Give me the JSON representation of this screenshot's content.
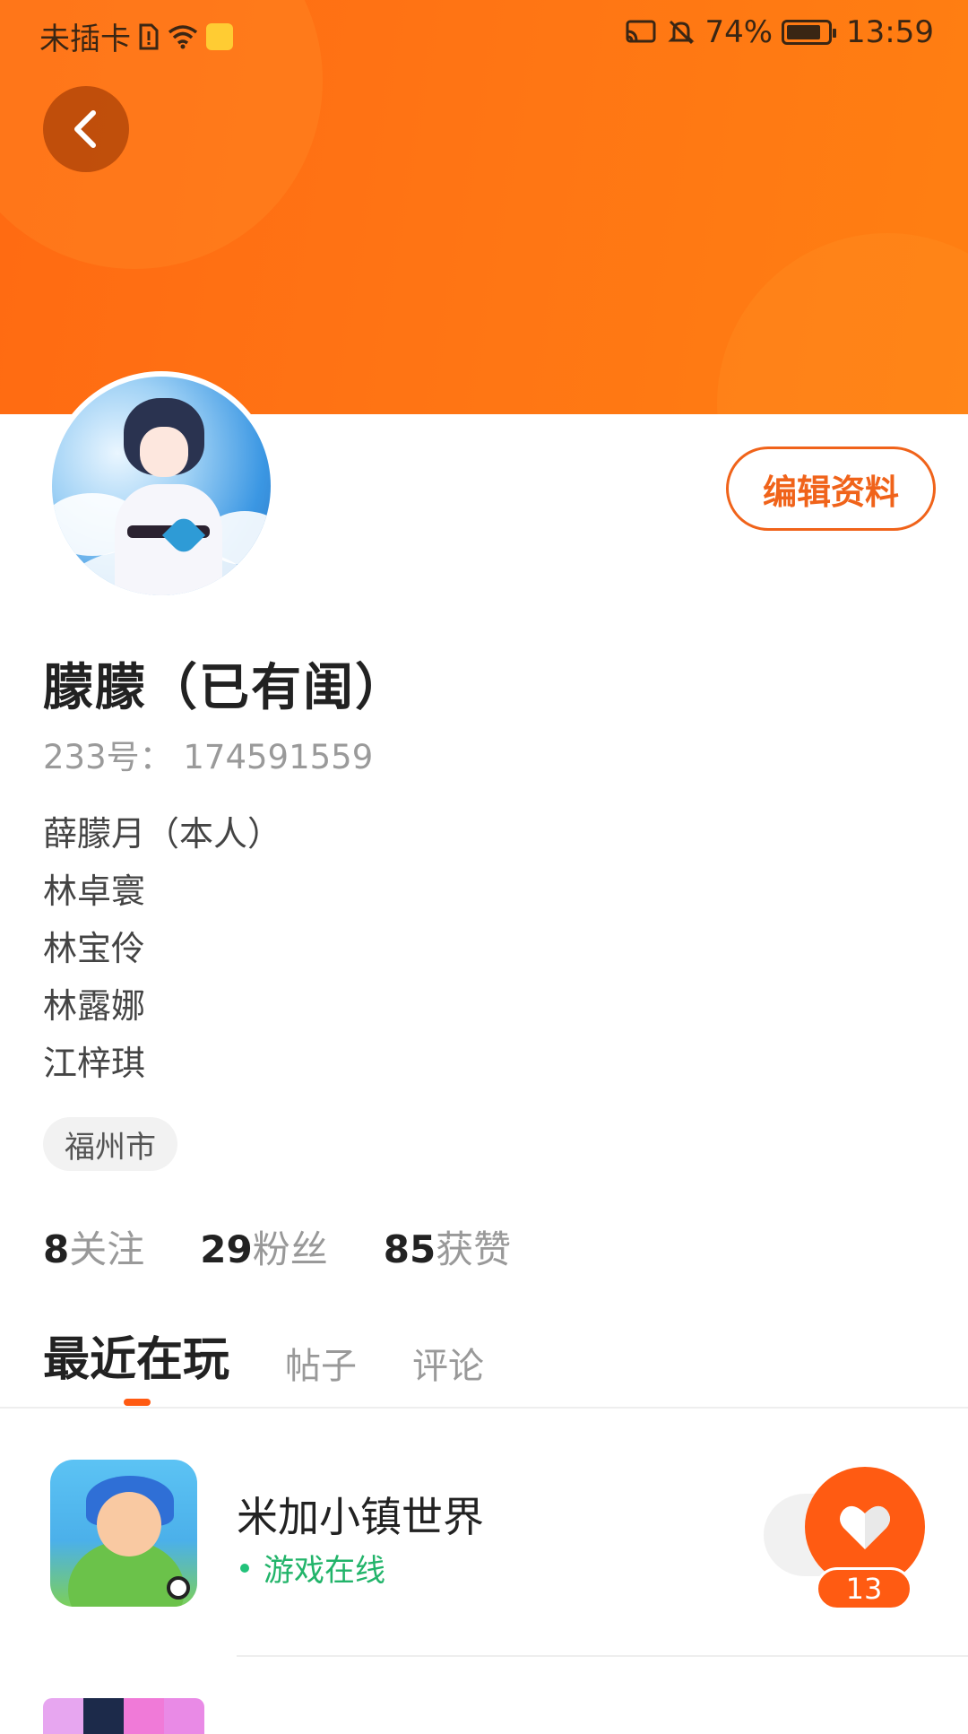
{
  "status_bar": {
    "carrier": "未插卡",
    "battery_percent": "74%",
    "battery_level": 0.74,
    "time": "13:59"
  },
  "header": {
    "back_icon": "chevron-left-icon",
    "banner_color": "#ff7414"
  },
  "profile": {
    "avatar_icon": "avatar-anime-girl",
    "edit_label": "编辑资料",
    "nickname": "朦朦（已有闺）",
    "uid": "233号：  174591559",
    "bio_lines": [
      "薛朦月（本人）",
      "林卓寰",
      "林宝伶",
      "林露娜",
      "江梓琪"
    ],
    "location": "福州市",
    "stats": [
      {
        "num": "8",
        "label": "关注"
      },
      {
        "num": "29",
        "label": "粉丝"
      },
      {
        "num": "85",
        "label": "获赞"
      }
    ]
  },
  "tabs": [
    "最近在玩",
    "帖子",
    "评论"
  ],
  "accent_color": "#ff5a12",
  "games": [
    {
      "name": "米加小镇世界",
      "status": "游戏在线",
      "like_count": "13",
      "like_icon": "heart-icon"
    }
  ]
}
